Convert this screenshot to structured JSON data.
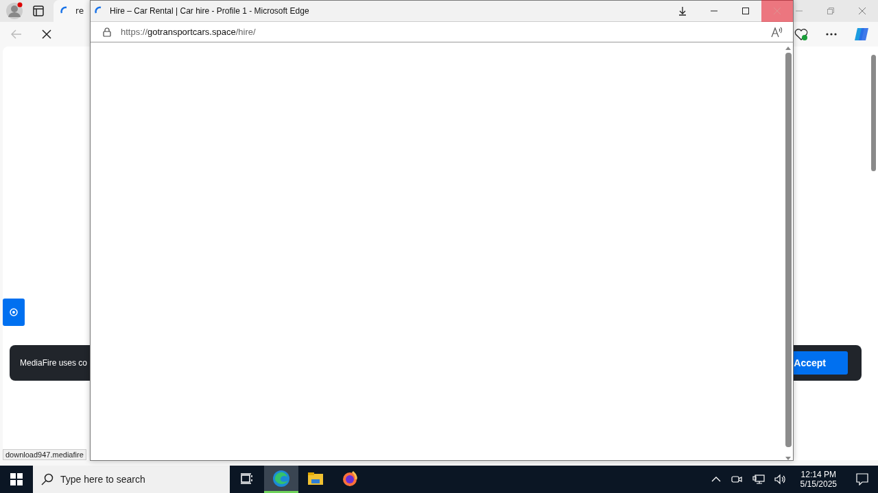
{
  "browser": {
    "tab": {
      "title": "re",
      "loading": true
    },
    "status_text": "download947.mediafire",
    "page": {
      "cookie_banner": {
        "text": "MediaFire uses co",
        "button": "Accept"
      }
    }
  },
  "popup": {
    "title": "Hire – Car Rental | Car hire - Profile 1 - Microsoft Edge",
    "loading": true,
    "close_hovered": true,
    "url": {
      "scheme": "https://",
      "host": "gotransportcars.space",
      "path": "/hire/"
    }
  },
  "taskbar": {
    "search": {
      "placeholder": "Type here to search"
    },
    "apps": [
      {
        "kind": "taskview",
        "active": false
      },
      {
        "kind": "edge",
        "active": true
      },
      {
        "kind": "explorer",
        "active": false
      },
      {
        "kind": "firefox",
        "active": false
      }
    ],
    "clock": {
      "time": "12:14 PM",
      "date": "5/15/2025"
    }
  }
}
